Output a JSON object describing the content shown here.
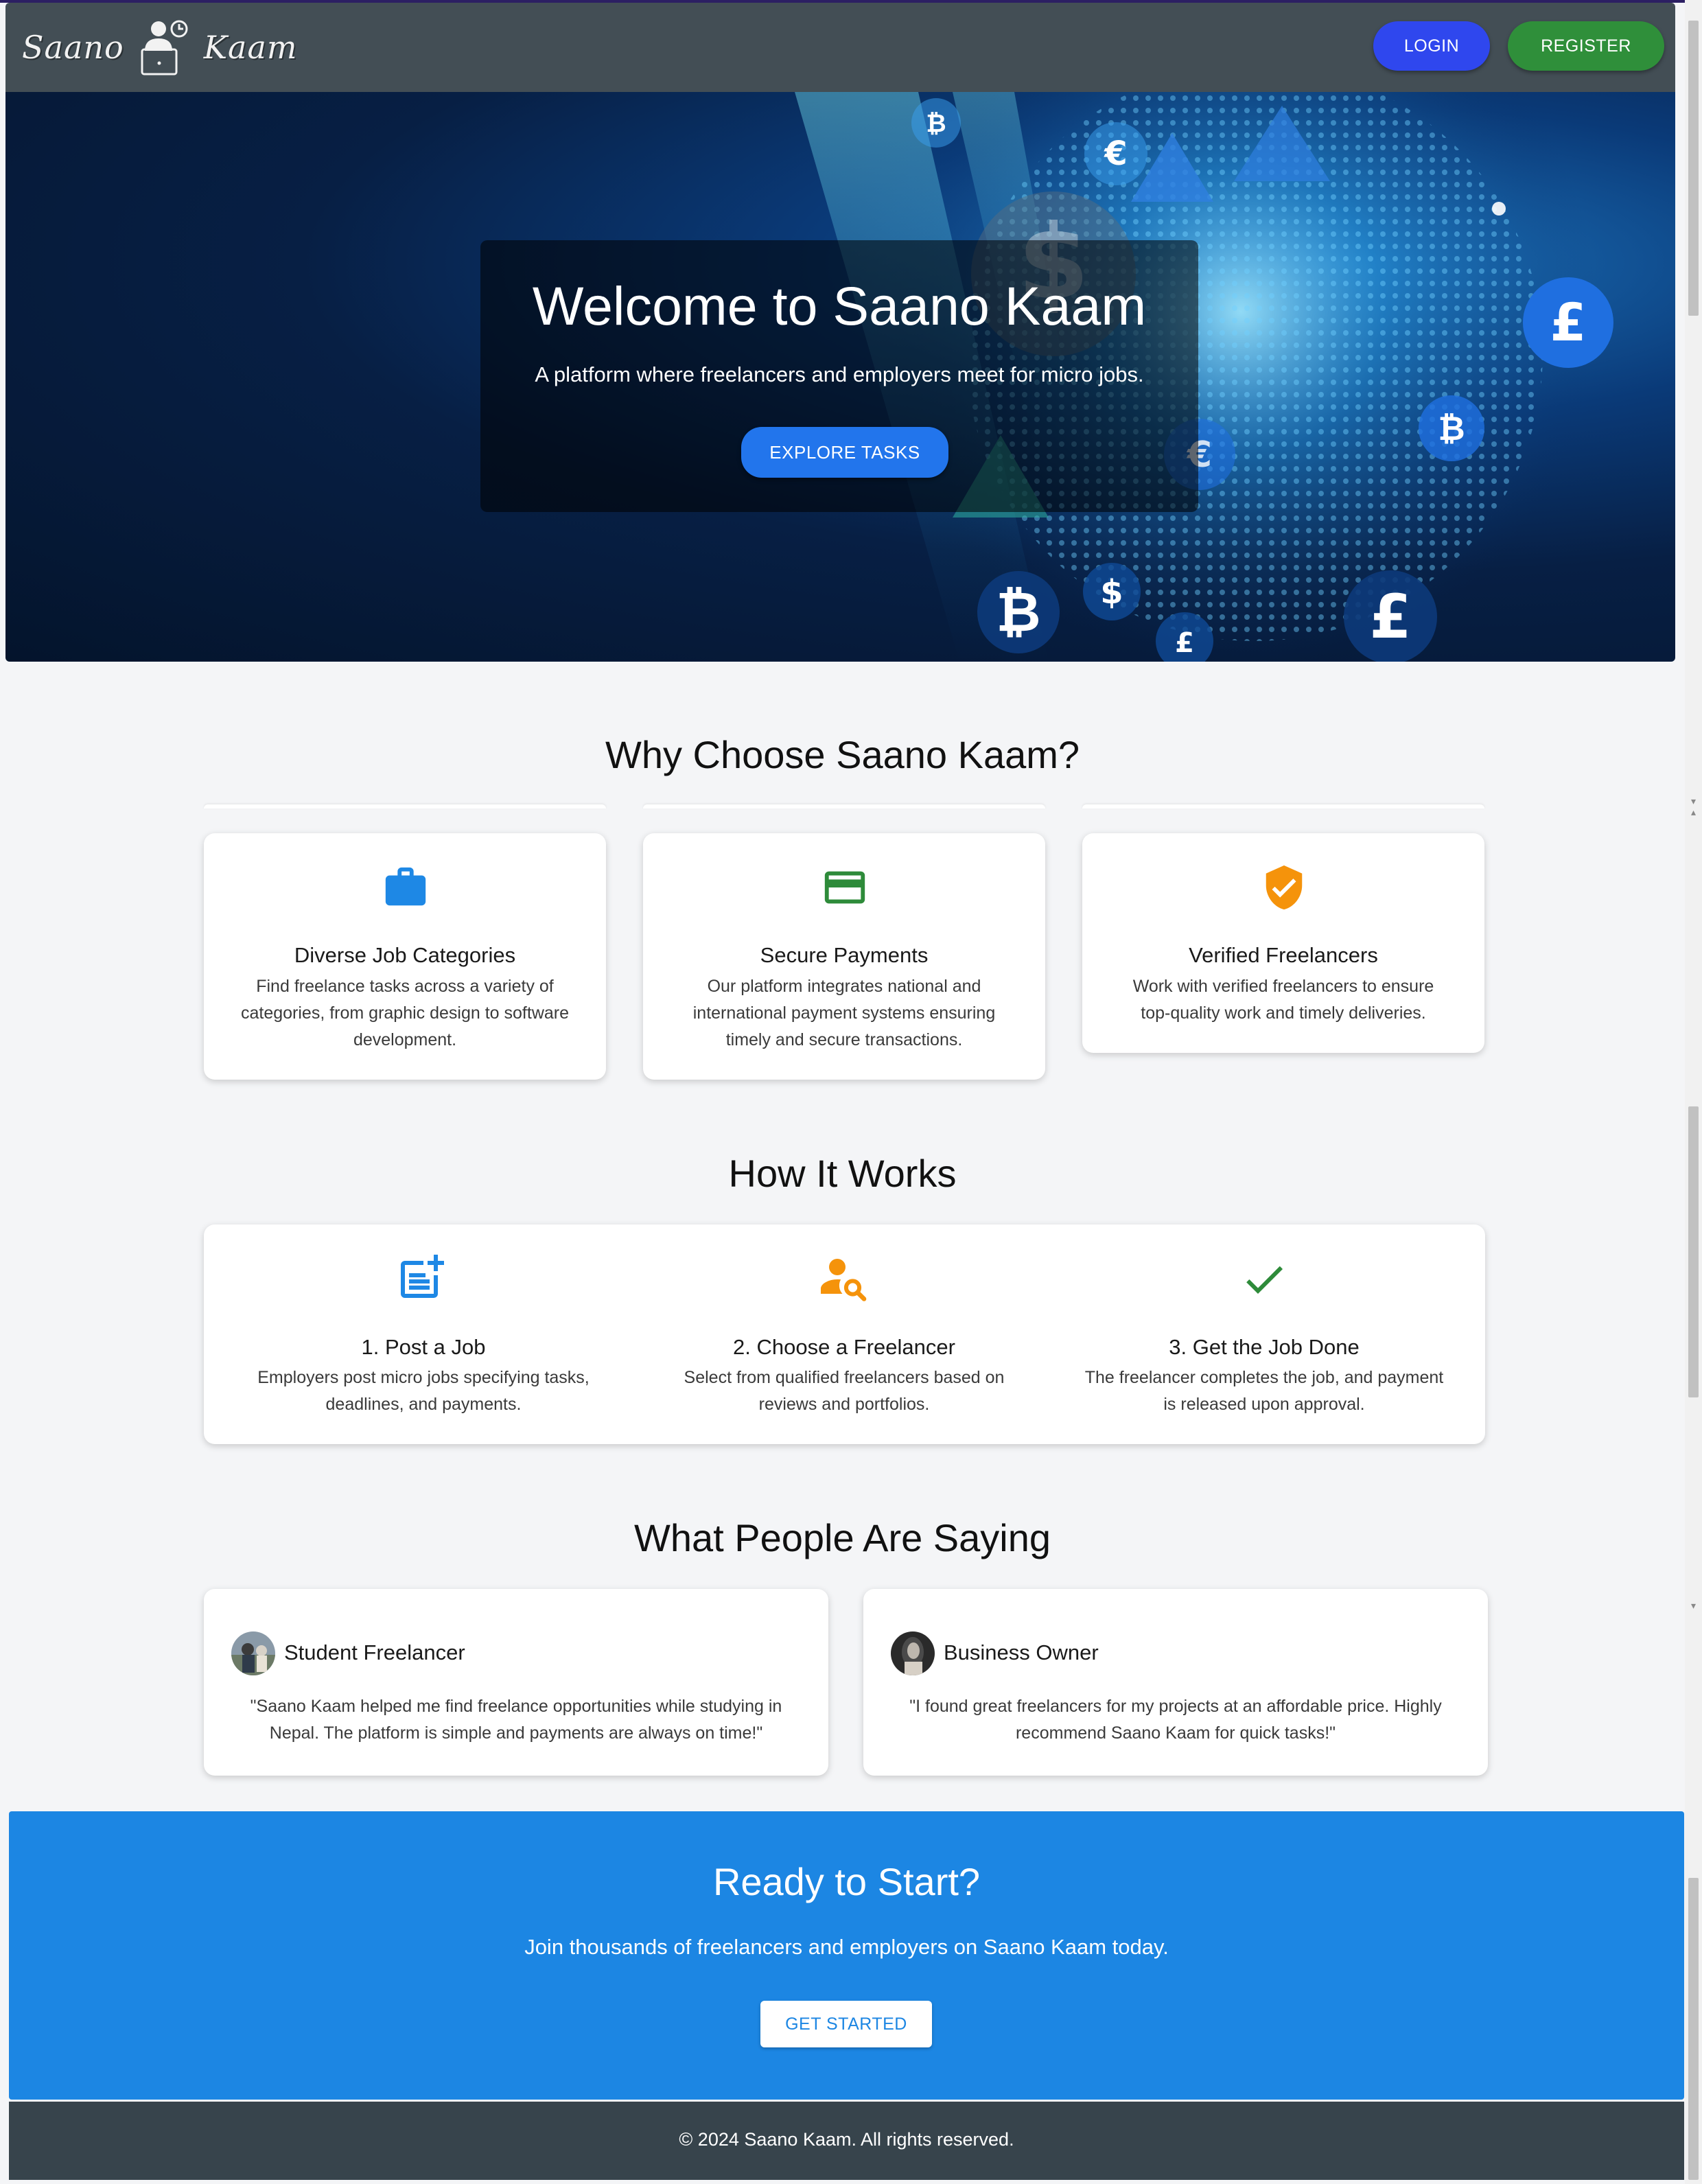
{
  "brand": {
    "name_left": "Saano",
    "name_right": "Kaam"
  },
  "nav": {
    "login_label": "LOGIN",
    "register_label": "REGISTER"
  },
  "hero": {
    "title": "Welcome to Saano Kaam",
    "subtitle": "A platform where freelancers and employers meet for micro jobs.",
    "cta_label": "EXPLORE TASKS"
  },
  "features": {
    "title": "Why Choose Saano Kaam?",
    "items": [
      {
        "icon": "briefcase-icon",
        "color": "#1e88e5",
        "title": "Diverse Job Categories",
        "lines": [
          "Find freelance tasks across a variety of",
          "categories, from graphic design to software",
          "development."
        ]
      },
      {
        "icon": "credit-card-icon",
        "color": "#2e8b3a",
        "title": "Secure Payments",
        "lines": [
          "Our platform integrates national and",
          "international payment systems ensuring",
          "timely and secure transactions."
        ]
      },
      {
        "icon": "verified-shield-icon",
        "color": "#f5930b",
        "title": "Verified Freelancers",
        "lines": [
          "Work with verified freelancers to ensure",
          "top-quality work and timely deliveries."
        ]
      }
    ]
  },
  "how": {
    "title": "How It Works",
    "steps": [
      {
        "icon": "post-add-icon",
        "color": "#1e88e5",
        "title": "1. Post a Job",
        "lines": [
          "Employers post micro jobs specifying tasks,",
          "deadlines, and payments."
        ]
      },
      {
        "icon": "person-search-icon",
        "color": "#f5930b",
        "title": "2. Choose a Freelancer",
        "lines": [
          "Select from qualified freelancers based on",
          "reviews and portfolios."
        ]
      },
      {
        "icon": "check-icon",
        "color": "#2e8b3a",
        "title": "3. Get the Job Done",
        "lines": [
          "The freelancer completes the job, and payment",
          "is released upon approval."
        ]
      }
    ]
  },
  "testimonials": {
    "title": "What People Are Saying",
    "items": [
      {
        "name": "Student Freelancer",
        "lines": [
          "\"Saano Kaam helped me find freelance opportunities while studying in",
          "Nepal. The platform is simple and payments are always on time!\""
        ]
      },
      {
        "name": "Business Owner",
        "lines": [
          "\"I found great freelancers for my projects at an affordable price. Highly",
          "recommend Saano Kaam for quick tasks!\""
        ]
      }
    ]
  },
  "cta": {
    "title": "Ready to Start?",
    "subtitle": "Join thousands of freelancers and employers on Saano Kaam today.",
    "button_label": "GET STARTED"
  },
  "footer": {
    "text": "© 2024 Saano Kaam. All rights reserved."
  },
  "colors": {
    "navbar": "#434e55",
    "login": "#2f47ee",
    "register": "#2f8f3a",
    "accent_blue": "#1c86e3",
    "footer": "#37444c"
  }
}
